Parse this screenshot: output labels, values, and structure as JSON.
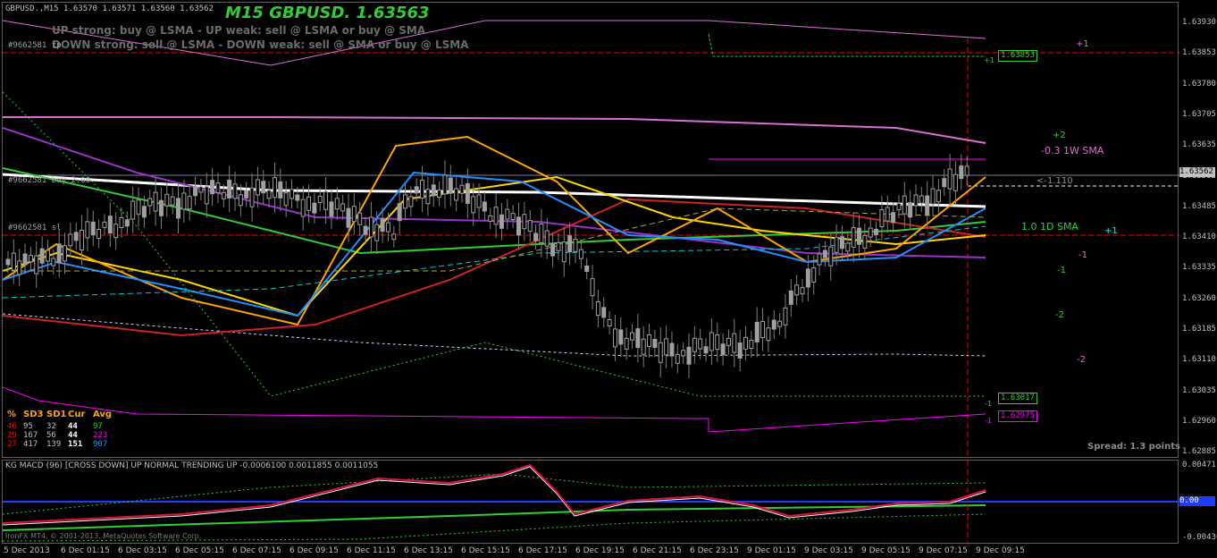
{
  "window": {
    "title_line": "GBPUSD.,M15  1.63570 1.63571 1.63560 1.63562",
    "big_title": "M15 GBPUSD. 1.63563",
    "info_line1": "UP strong: buy @ LSMA - UP weak: sell @ LSMA or buy @ SMA",
    "info_line2": "DOWN strong: sell @ LSMA - DOWN weak: sell @ SMA or buy @ LSMA",
    "tag_top": "#9662581 tp",
    "tag_mid": "#9662581 buy 2.00",
    "tag_sl": "#9662581 sl"
  },
  "right_labels": {
    "plus1_top": "+1",
    "plus2": "+2",
    "sma_1w": "-0.3 1W SMA",
    "pivot_val": "<-1.110",
    "sma_1d": "1.0 1D SMA",
    "plus1_mid": "+1",
    "minus1_a": "-1",
    "minus1_b": "-1",
    "minus2_a": "-2",
    "minus2_b": "-2",
    "spread": "Spread: 1.3 points",
    "box_high": "1.63853",
    "box_high_marker": "+1",
    "box_low_green": "1.63017",
    "box_low_green_marker": "-1",
    "box_low_mag": "1.62975",
    "box_low_mag_marker": "-1"
  },
  "stats_table": {
    "headers": [
      "%",
      "SD3",
      "SD1",
      "Cur",
      "Avg"
    ],
    "rows": [
      [
        "46",
        "95",
        "32",
        "44",
        "97"
      ],
      [
        "29",
        "167",
        "56",
        "44",
        "223"
      ],
      [
        "27",
        "417",
        "139",
        "151",
        "907"
      ]
    ]
  },
  "price_axis": [
    "1.63930",
    "1.63853",
    "1.63780",
    "1.63705",
    "1.63635",
    "1.63562",
    "1.63485",
    "1.63410",
    "1.63335",
    "1.63260",
    "1.63185",
    "1.63110",
    "1.63035",
    "1.62960",
    "1.62885"
  ],
  "current_price": "1.63562",
  "macd": {
    "title": "KG MACD (96)  [CROSS DOWN]  UP  NORMAL  TRENDING UP -0.0006100 0.0011855 0.0011055",
    "axis": [
      "0.00471",
      "0.00",
      "-0.00430"
    ],
    "copyright": "IronFX MT4, © 2001-2013, MetaQuotes Software Corp."
  },
  "time_axis": [
    "5 Dec 2013",
    "6 Dec 01:15",
    "6 Dec 03:15",
    "6 Dec 05:15",
    "6 Dec 07:15",
    "6 Dec 09:15",
    "6 Dec 11:15",
    "6 Dec 13:15",
    "6 Dec 15:15",
    "6 Dec 17:15",
    "6 Dec 19:15",
    "6 Dec 21:15",
    "6 Dec 23:15",
    "9 Dec 01:15",
    "9 Dec 03:15",
    "9 Dec 05:15",
    "9 Dec 07:15",
    "9 Dec 09:15"
  ],
  "colors": {
    "green_bright": "#32cd32",
    "magenta": "#ff00ff",
    "orchid": "#da70d6",
    "gold": "#ffd700",
    "orange": "#ffa500",
    "blue": "#1e90ff",
    "red": "#ff0000",
    "white": "#ffffff"
  }
}
